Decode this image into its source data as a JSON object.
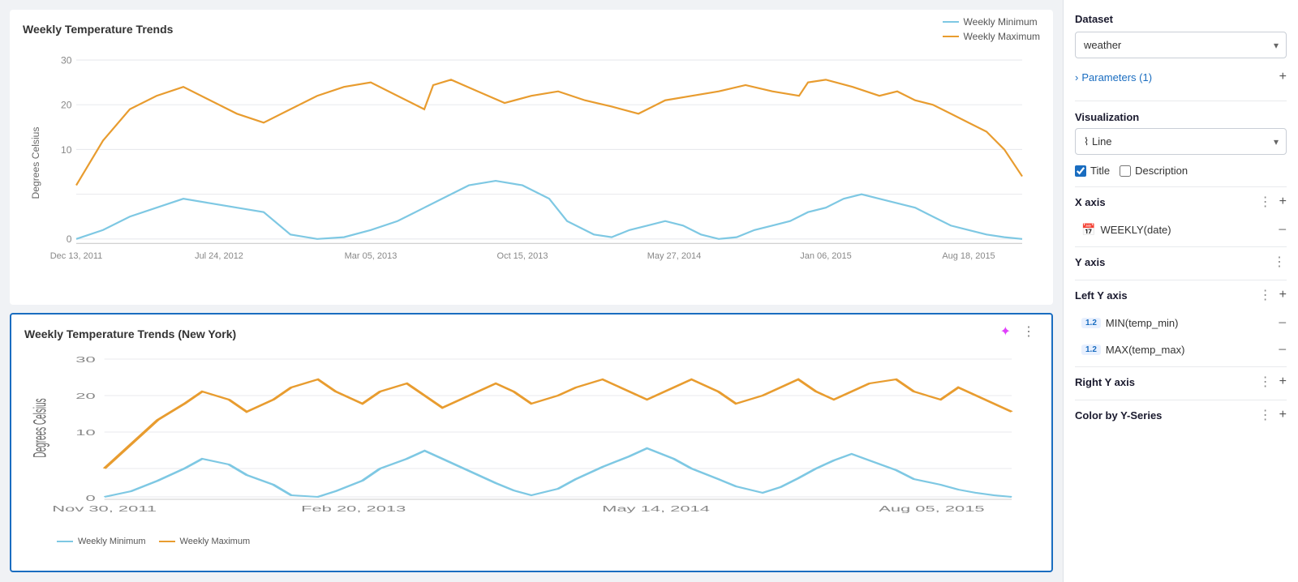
{
  "main": {
    "topChart": {
      "title": "Weekly Temperature Trends",
      "yAxisLabel": "Degrees Celsius",
      "xLabels": [
        "Dec 13, 2011",
        "Jul 24, 2012",
        "Mar 05, 2013",
        "Oct 15, 2013",
        "May 27, 2014",
        "Jan 06, 2015",
        "Aug 18, 2015"
      ],
      "legend": {
        "min": "Weekly Minimum",
        "max": "Weekly Maximum"
      }
    },
    "bottomChart": {
      "title": "Weekly Temperature Trends (New York)",
      "yAxisLabel": "Degrees Celsius",
      "xLabels": [
        "Nov 30, 2011",
        "Feb 20, 2013",
        "May 14, 2014",
        "Aug 05, 2015"
      ],
      "legend": {
        "min": "Weekly Minimum",
        "max": "Weekly Maximum"
      }
    }
  },
  "panel": {
    "datasetLabel": "Dataset",
    "datasetValue": "weather",
    "parametersLabel": "Parameters (1)",
    "visualizationLabel": "Visualization",
    "visualizationValue": "Line",
    "titleLabel": "Title",
    "descriptionLabel": "Description",
    "xAxisLabel": "X axis",
    "xAxisItem": "WEEKLY(date)",
    "yAxisLabel": "Y axis",
    "leftYAxisLabel": "Left Y axis",
    "leftYAxisItems": [
      {
        "badge": "1.2",
        "label": "MIN(temp_min)"
      },
      {
        "badge": "1.2",
        "label": "MAX(temp_max)"
      }
    ],
    "rightYAxisLabel": "Right Y axis",
    "colorByLabel": "Color by Y-Series"
  }
}
